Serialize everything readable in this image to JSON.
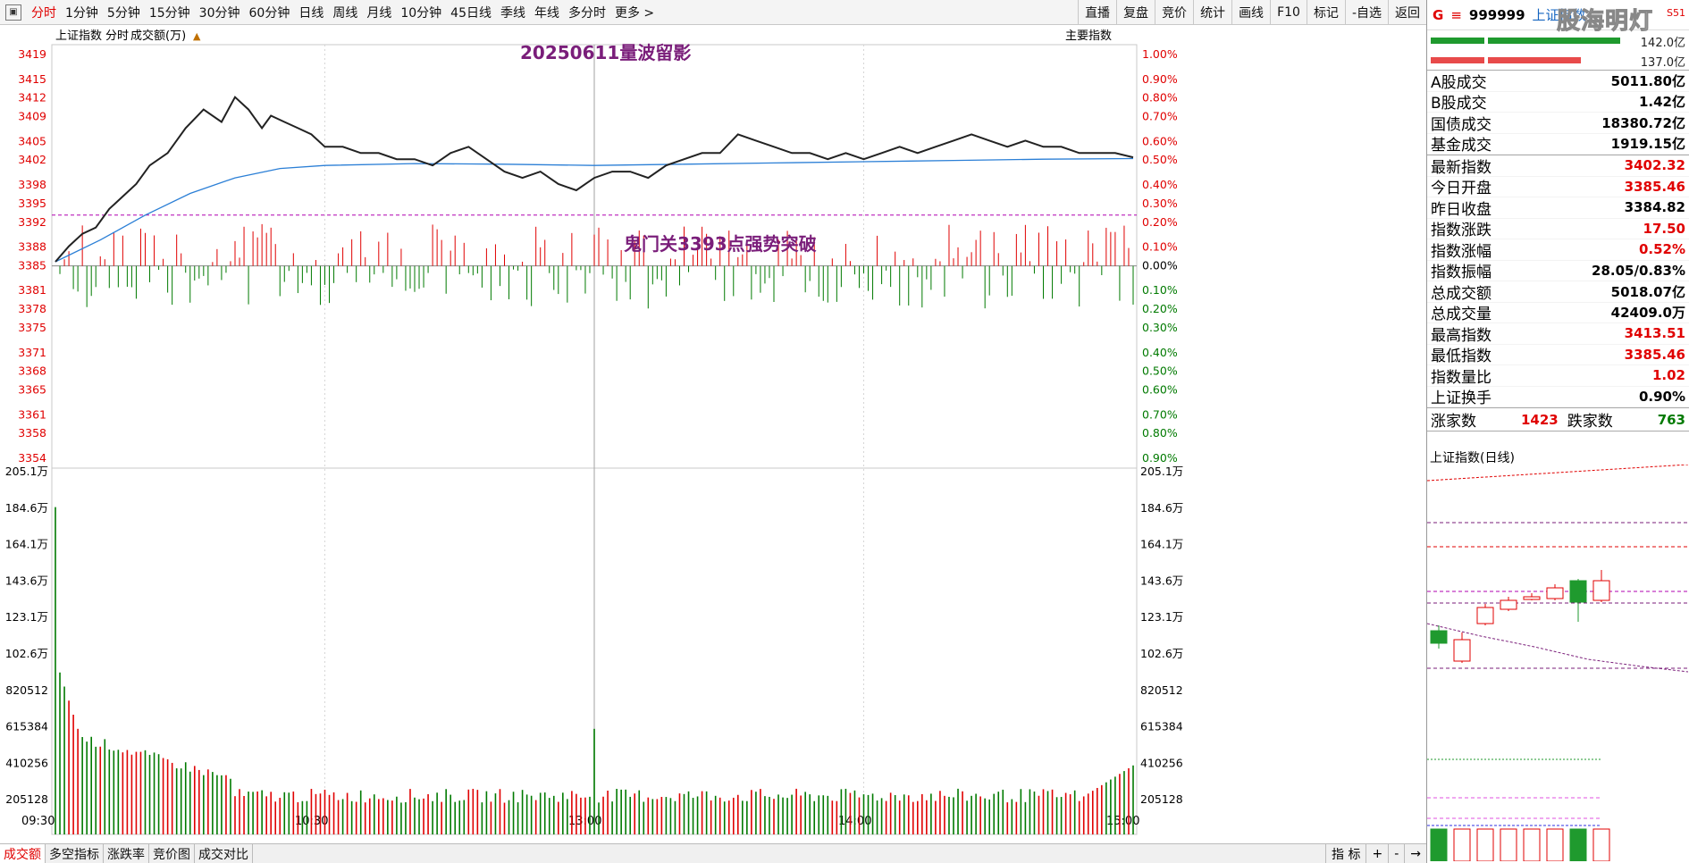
{
  "toolbar": {
    "periods": [
      "分时",
      "1分钟",
      "5分钟",
      "15分钟",
      "30分钟",
      "60分钟",
      "日线",
      "周线",
      "月线",
      "10分钟",
      "45日线",
      "季线",
      "年线",
      "多分时",
      "更多 >"
    ],
    "active_period": 0,
    "right_buttons": [
      "直播",
      "复盘",
      "竞价",
      "统计",
      "画线",
      "F10",
      "标记",
      "-自选",
      "返回"
    ]
  },
  "chart": {
    "top_label_index": "上证指数",
    "top_label_mode": "分时",
    "top_label_metric": "成交额(万)",
    "main_index_label": "主要指数",
    "annotation_title": "20250611量波留影",
    "annotation_note": "鬼门关3393点强势突破",
    "time_labels": [
      "09:30",
      "10:30",
      "13:00",
      "14:00",
      "15:00"
    ],
    "vol_axis_labels": [
      "205.1万",
      "184.6万",
      "164.1万",
      "143.6万",
      "123.1万",
      "102.6万",
      "820512",
      "615384",
      "410256",
      "205128"
    ],
    "price_colors": {
      "line": "#222222",
      "avg": "#2b7fd6",
      "up": "#e00000",
      "down": "#007a00",
      "dash": "#b000b0"
    }
  },
  "chart_data": {
    "type": "line",
    "title": "20250611量波留影",
    "x_ticks": [
      "09:30",
      "10:30",
      "13:00",
      "14:00",
      "15:00"
    ],
    "price_axis": [
      3419,
      3415,
      3412,
      3409,
      3405,
      3402,
      3398,
      3395,
      3392,
      3388,
      3385,
      3381,
      3378,
      3375,
      3371,
      3368,
      3365,
      3361,
      3358,
      3354
    ],
    "pct_axis": [
      "1.00%",
      "0.90%",
      "0.80%",
      "0.70%",
      "0.60%",
      "0.50%",
      "0.40%",
      "0.30%",
      "0.20%",
      "0.10%",
      "0.00%",
      "0.10%",
      "0.20%",
      "0.30%",
      "0.40%",
      "0.50%",
      "0.60%",
      "0.70%",
      "0.80%",
      "0.90%"
    ],
    "ylim": [
      3354,
      3419
    ],
    "base_close": 3384.82,
    "reference_line": 3393,
    "series": [
      {
        "name": "上证指数",
        "x": [
          0,
          3,
          6,
          9,
          12,
          15,
          18,
          21,
          25,
          29,
          33,
          37,
          40,
          43,
          46,
          48,
          51,
          54,
          57,
          60,
          64,
          68,
          72,
          76,
          80,
          84,
          88,
          92,
          96,
          100,
          104,
          108,
          112,
          116,
          120,
          124,
          128,
          132,
          136,
          140,
          144,
          148,
          152,
          156,
          160,
          164,
          168,
          172,
          176,
          180,
          184,
          188,
          192,
          196,
          200,
          204,
          208,
          212,
          216,
          220,
          224,
          228,
          232,
          236,
          240
        ],
        "y": [
          3385.5,
          3388,
          3390,
          3391,
          3394,
          3396,
          3398,
          3401,
          3403,
          3407,
          3410,
          3408,
          3412,
          3410,
          3407,
          3409,
          3408,
          3407,
          3406,
          3404,
          3404,
          3403,
          3403,
          3402,
          3402,
          3401,
          3403,
          3404,
          3402,
          3400,
          3399,
          3400,
          3398,
          3397,
          3399,
          3400,
          3400,
          3399,
          3401,
          3402,
          3403,
          3403,
          3406,
          3405,
          3404,
          3403,
          3403,
          3402,
          3403,
          3402,
          3403,
          3404,
          3403,
          3404,
          3405,
          3406,
          3405,
          3404,
          3405,
          3404,
          3404,
          3403,
          3403,
          3403,
          3402.3
        ]
      },
      {
        "name": "均线",
        "x": [
          0,
          10,
          20,
          30,
          40,
          50,
          60,
          80,
          100,
          120,
          140,
          160,
          180,
          200,
          220,
          240
        ],
        "y": [
          3385.5,
          3389,
          3393,
          3396.5,
          3399,
          3400.5,
          3401,
          3401.3,
          3401.2,
          3401.0,
          3401.2,
          3401.4,
          3401.6,
          3401.8,
          3402.0,
          3402.1
        ]
      }
    ],
    "volume_ylim": [
      0,
      2051000
    ],
    "volume_first_bar": 1860000,
    "volume_1300_bar": 600000
  },
  "right_panel": {
    "g_label": "G",
    "menu_icon": "≡",
    "code": "999999",
    "name": "上证指数",
    "logo_text": "股海明灯",
    "corner_text": "S51",
    "bar1_value": "142.0亿",
    "bar2_value": "137.0亿",
    "stats": [
      {
        "label": "A股成交",
        "value": "5011.80亿",
        "color": "#000000"
      },
      {
        "label": "B股成交",
        "value": "1.42亿",
        "color": "#000000"
      },
      {
        "label": "国债成交",
        "value": "18380.72亿",
        "color": "#000000"
      },
      {
        "label": "基金成交",
        "value": "1919.15亿",
        "color": "#000000"
      }
    ],
    "stats2": [
      {
        "label": "最新指数",
        "value": "3402.32",
        "color": "#e00000"
      },
      {
        "label": "今日开盘",
        "value": "3385.46",
        "color": "#e00000"
      },
      {
        "label": "昨日收盘",
        "value": "3384.82",
        "color": "#000000"
      },
      {
        "label": "指数涨跌",
        "value": "17.50",
        "color": "#e00000"
      },
      {
        "label": "指数涨幅",
        "value": "0.52%",
        "color": "#e00000"
      },
      {
        "label": "指数振幅",
        "value": "28.05/0.83%",
        "color": "#000000"
      },
      {
        "label": "总成交额",
        "value": "5018.07亿",
        "color": "#000000"
      },
      {
        "label": "总成交量",
        "value": "42409.0万",
        "color": "#000000"
      },
      {
        "label": "最高指数",
        "value": "3413.51",
        "color": "#e00000"
      },
      {
        "label": "最低指数",
        "value": "3385.46",
        "color": "#e00000"
      },
      {
        "label": "指数量比",
        "value": "1.02",
        "color": "#e00000"
      },
      {
        "label": "上证换手",
        "value": "0.90%",
        "color": "#000000"
      }
    ],
    "up_label": "涨家数",
    "up_count": "1423",
    "down_label": "跌家数",
    "down_count": "763",
    "mini_title": "上证指数(日线)"
  },
  "bottom_tabs": [
    "成交额",
    "多空指标",
    "涨跌率",
    "竞价图",
    "成交对比"
  ],
  "bottom_right": [
    "指 标",
    "+",
    "-",
    "→"
  ]
}
